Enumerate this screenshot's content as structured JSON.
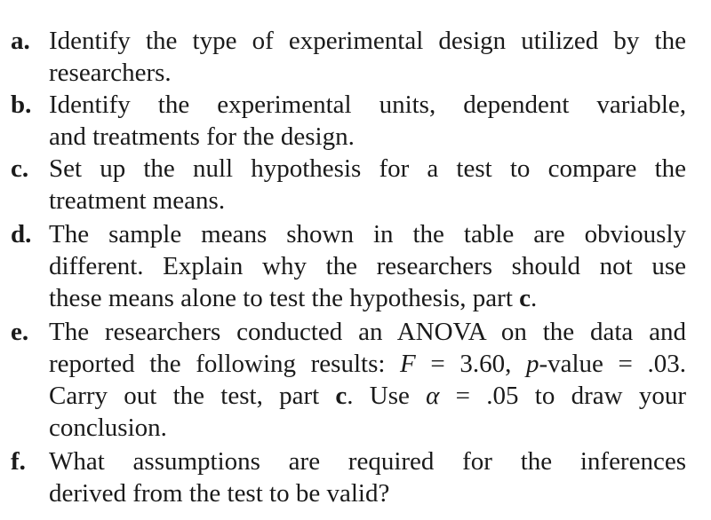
{
  "items": [
    {
      "label": "a.",
      "lines": [
        "Identify the type of experimental design utilized by the",
        "researchers."
      ]
    },
    {
      "label": "b.",
      "lines": [
        "Identify the experimental units, dependent variable,",
        "and treatments for the design."
      ]
    },
    {
      "label": "c.",
      "lines": [
        "Set up the null hypothesis for a test to compare the",
        "treatment means."
      ]
    },
    {
      "label": "d.",
      "lines": [
        "The sample means shown in the table are obviously",
        "different. Explain why the researchers should not use",
        "these means alone to test the hypothesis, part ",
        "c",
        "."
      ]
    },
    {
      "label": "e.",
      "lines": [
        "The researchers conducted an ANOVA on the data and",
        "reported the following results: ",
        "F",
        " = 3.60, ",
        "p",
        "-value = .03.",
        "Carry out the test, part ",
        "c",
        ". Use ",
        "α",
        " = .05 to draw your",
        "conclusion."
      ]
    },
    {
      "label": "f.",
      "lines": [
        "What assumptions are required for the inferences",
        "derived from the test to be valid?"
      ]
    }
  ]
}
